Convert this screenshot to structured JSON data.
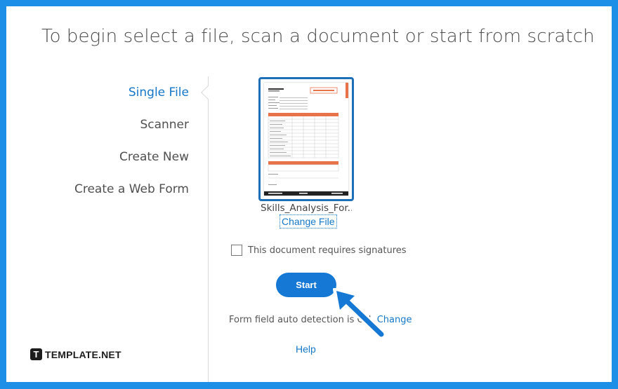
{
  "headline": "To begin select a file, scan a document or start from scratch",
  "nav": {
    "items": [
      {
        "label": "Single File",
        "active": true
      },
      {
        "label": "Scanner",
        "active": false
      },
      {
        "label": "Create New",
        "active": false
      },
      {
        "label": "Create a Web Form",
        "active": false
      }
    ]
  },
  "file": {
    "name": "Skills_Analysis_For...",
    "change_label": "Change File"
  },
  "signatures": {
    "label": "This document requires signatures",
    "checked": false
  },
  "start_label": "Start",
  "detection": {
    "text": "Form field auto detection is ON. ",
    "link": "Change"
  },
  "help_label": "Help",
  "brand": {
    "mark": "T",
    "text": "TEMPLATE.NET"
  },
  "colors": {
    "frame": "#1e8fe6",
    "accent": "#1477c8",
    "button": "#1478d4",
    "doc_orange": "#e8734a"
  },
  "icons": {
    "checkbox": "checkbox-unchecked",
    "pointer": "arrow-pointer-icon"
  }
}
